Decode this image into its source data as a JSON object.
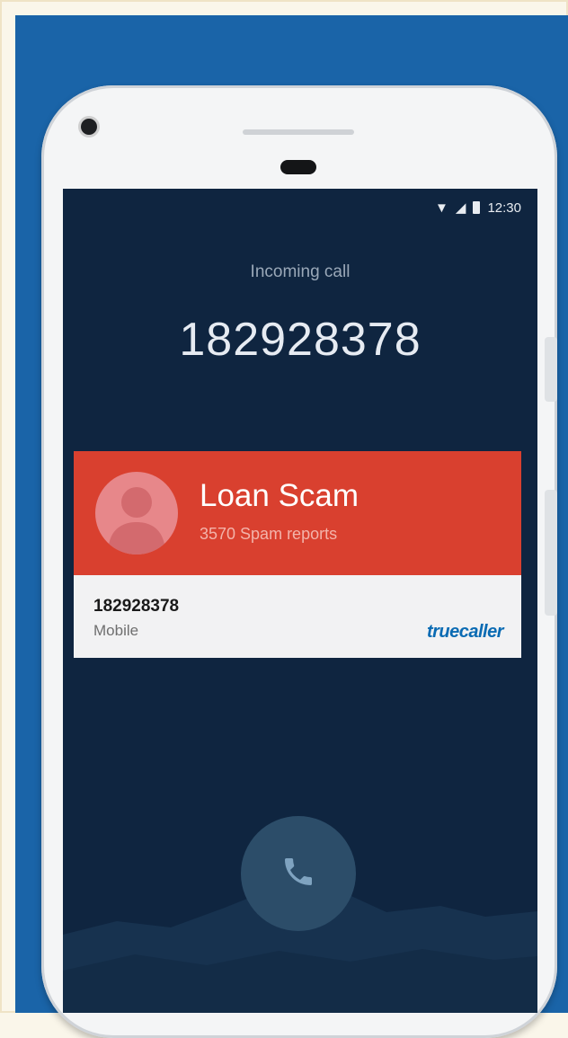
{
  "status_bar": {
    "time": "12:30",
    "wifi_icon": "wifi-icon",
    "signal_icon": "signal-icon",
    "battery_icon": "battery-icon"
  },
  "call": {
    "label": "Incoming call",
    "number": "182928378"
  },
  "spam_card": {
    "title": "Loan Scam",
    "subtitle": "3570 Spam reports",
    "color": "#d9402f",
    "avatar_icon": "person-avatar-icon"
  },
  "caller_info": {
    "number": "182928378",
    "type": "Mobile",
    "brand": "truecaller"
  },
  "answer_button": {
    "icon": "phone-icon"
  },
  "colors": {
    "background": "#1a64a8",
    "screen": "#0f2540",
    "brand": "#0a6bb3"
  }
}
